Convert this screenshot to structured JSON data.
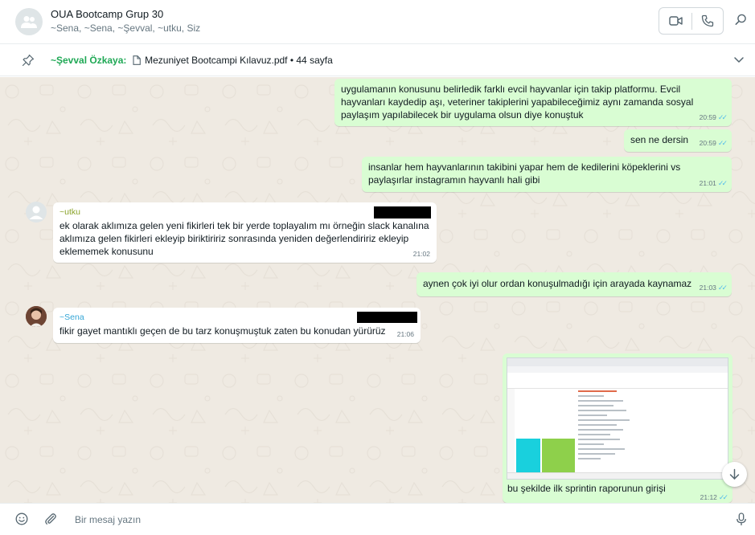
{
  "header": {
    "group_name": "OUA Bootcamp Grup 30",
    "members": "~Sena, ~Sena, ~Şevval, ~utku, Siz",
    "icons": [
      "group-avatar-icon",
      "video-call-icon",
      "voice-call-icon",
      "search-icon"
    ]
  },
  "pinned": {
    "sender": "~Şevval Özkaya:",
    "document": "Mezuniyet Bootcampi Kılavuz.pdf • 44 sayfa",
    "icons": [
      "pin-icon",
      "document-icon",
      "chevron-down-icon"
    ]
  },
  "messages": [
    {
      "direction": "outgoing",
      "text": "uygulamanın konusunu belirledik farklı evcil hayvanlar için takip platformu. Evcil hayvanları kaydedip aşı, veteriner takiplerini yapabileceğimiz aynı zamanda sosyal paylaşım yapılabilecek bir uygulama olsun diye konuştuk",
      "time": "20:59",
      "read": "✓✓"
    },
    {
      "direction": "outgoing",
      "text": "sen ne dersin",
      "time": "20:59",
      "read": "✓✓"
    },
    {
      "direction": "outgoing",
      "text": "insanlar hem hayvanlarının takibini yapar hem de kedilerini köpeklerini vs paylaşırlar instagramın hayvanlı hali gibi",
      "time": "21:01",
      "read": "✓✓"
    },
    {
      "direction": "incoming",
      "sender": "~utku",
      "text": "ek olarak aklımıza gelen yeni fikirleri tek bir yerde toplayalım mı örneğin slack kanalına aklımıza gelen fikirleri ekleyip biriktiririz sonrasında yeniden değerlendiririz ekleyip eklememek konusunu",
      "time": "21:02"
    },
    {
      "direction": "outgoing",
      "text": "aynen çok iyi olur ordan konuşulmadığı için arayada kaynamaz",
      "time": "21:03",
      "read": "✓✓"
    },
    {
      "direction": "incoming",
      "sender": "~Sena",
      "text": "fikir gayet mantıklı geçen de bu tarz konuşmuştuk zaten bu konudan yürürüz",
      "time": "21:06"
    },
    {
      "direction": "outgoing",
      "type": "image",
      "caption": "bu şekilde ilk sprintin raporunun girişi",
      "time": "21:12",
      "read": "✓✓"
    }
  ],
  "compose": {
    "placeholder": "Bir mesaj yazın",
    "icons": [
      "emoji-icon",
      "attach-icon",
      "mic-icon"
    ]
  },
  "scroll": {
    "icon": "arrow-down-icon"
  },
  "colors": {
    "chat_bg": "#efeae2",
    "outgoing_bubble": "#d9fdd3",
    "incoming_bubble": "#ffffff",
    "read_tick": "#53bdeb",
    "utku_name": "#8aa32a",
    "sena_name": "#35a6d6",
    "pinned_sender": "#1fa855"
  }
}
